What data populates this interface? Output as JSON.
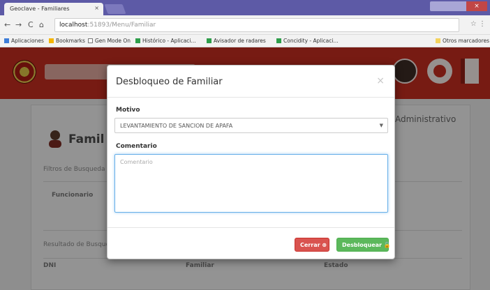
{
  "browser": {
    "tab_title": "Geoclave - Familiares",
    "tab_close": "×",
    "back": "←",
    "forward": "→",
    "reload": "C",
    "home": "⌂",
    "url_host": "localhost",
    "url_path": ":51893/Menu/Familiar",
    "bookmarks": [
      {
        "label": "Aplicaciones",
        "icon_color": "#3d7dd8"
      },
      {
        "label": "Bookmarks",
        "icon_color": "#f4b400"
      },
      {
        "label": "Gen Mode On",
        "icon_color": "#777777"
      },
      {
        "label": "Histórico - Aplicaci...",
        "icon_color": "#2e9e4a"
      },
      {
        "label": "Avisador de radares",
        "icon_color": "#2e9e4a"
      },
      {
        "label": "Concidity - Aplicaci...",
        "icon_color": "#2e9e4a"
      }
    ],
    "other_bookmarks": "Otros marcadores"
  },
  "background_page": {
    "title": "Famil",
    "admin_label": "Administrativo",
    "filter_label": "Filtros de Busqueda",
    "funcionario_label": "Funcionario",
    "results_label": "Resultado de Busqueda",
    "col_dni": "DNI",
    "col_familiar": "Familiar",
    "col_estado": "Estado"
  },
  "modal": {
    "title": "Desbloqueo de Familiar",
    "close": "×",
    "motivo_label": "Motivo",
    "motivo_value": "LEVANTAMIENTO DE SANCION DE APAFA",
    "comentario_label": "Comentario",
    "comentario_placeholder": "Comentario",
    "cancel_label": "Cerrar ⊗",
    "confirm_label": "Desbloquear 🔓"
  },
  "colors": {
    "app_bar": "#c12d20",
    "danger": "#d9534f",
    "success": "#5cb85c",
    "focus": "#66afe9"
  }
}
